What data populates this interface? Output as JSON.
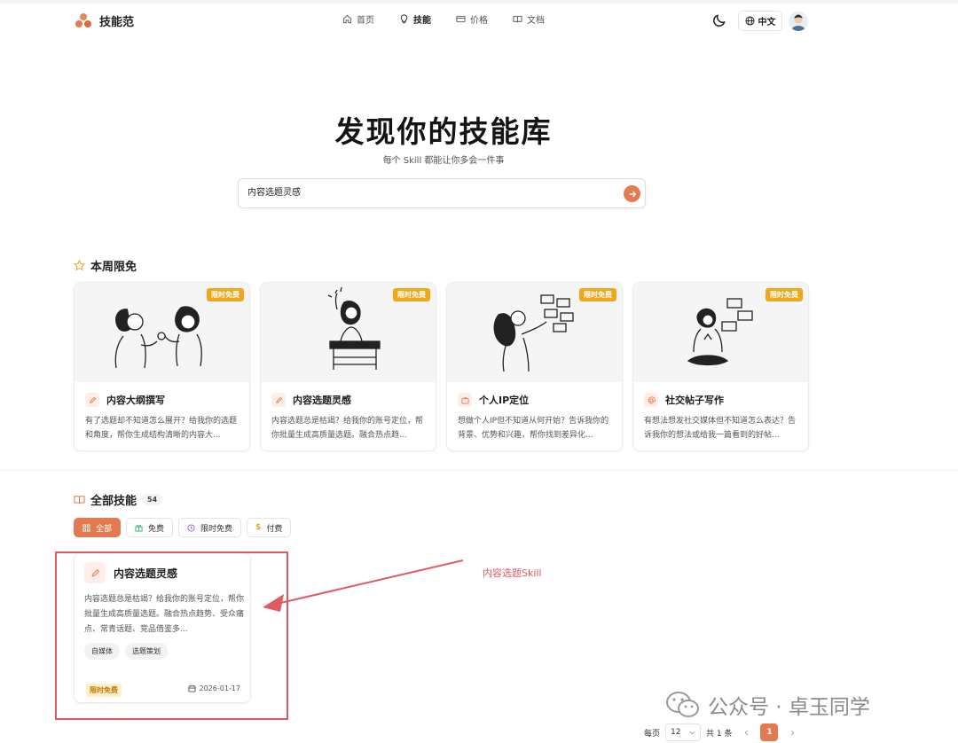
{
  "brand": {
    "name": "技能范",
    "accent": "#e47a50"
  },
  "nav": [
    {
      "label": "首页",
      "icon": "home-icon"
    },
    {
      "label": "技能",
      "icon": "lightbulb-icon",
      "active": true
    },
    {
      "label": "价格",
      "icon": "credit-card-icon"
    },
    {
      "label": "文档",
      "icon": "book-icon"
    }
  ],
  "header": {
    "lang_label": "中文"
  },
  "hero": {
    "title": "发现你的技能库",
    "subtitle": "每个 Skill 都能让你多会一件事",
    "search_value": "内容选题灵感"
  },
  "weekly_free": {
    "title": "本周限免",
    "cards": [
      {
        "badge": "限时免费",
        "icon": "pencil-icon",
        "title": "内容大纲撰写",
        "desc": "有了选题却不知道怎么展开？给我你的选题和角度，帮你生成结构清晰的内容大..."
      },
      {
        "badge": "限时免费",
        "icon": "pencil-icon",
        "title": "内容选题灵感",
        "desc": "内容选题总是枯竭？给我你的账号定位，帮你批量生成高质量选题。融合热点趋..."
      },
      {
        "badge": "限时免费",
        "icon": "briefcase-icon",
        "title": "个人IP定位",
        "desc": "想做个人IP但不知道从何开始？告诉我你的背景、优势和兴趣，帮你找到差异化..."
      },
      {
        "badge": "限时免费",
        "icon": "at-icon",
        "title": "社交帖子写作",
        "desc": "有想法想发社交媒体但不知道怎么表达？告诉我你的想法或给我一篇看到的好帖..."
      }
    ]
  },
  "all_skills": {
    "title": "全部技能",
    "count": "54",
    "filters": [
      {
        "label": "全部",
        "active": true
      },
      {
        "label": "免费"
      },
      {
        "label": "限时免费"
      },
      {
        "label": "付费"
      }
    ],
    "skill": {
      "title": "内容选题灵感",
      "desc": "内容选题总是枯竭？给我你的账号定位，帮你批量生成高质量选题。融合热点趋势、受众痛点、常青话题、竞品借鉴多...",
      "tags": [
        "自媒体",
        "选题策划"
      ],
      "badge": "限时免费",
      "date": "2026-01-17"
    }
  },
  "annotation": {
    "text": "内容选题Skill"
  },
  "pagination": {
    "per_page_label": "每页",
    "per_page_value": "12",
    "total_label": "共 1 条",
    "current_page": "1"
  },
  "watermark": {
    "text": "公众号 · 卓玉同学"
  }
}
